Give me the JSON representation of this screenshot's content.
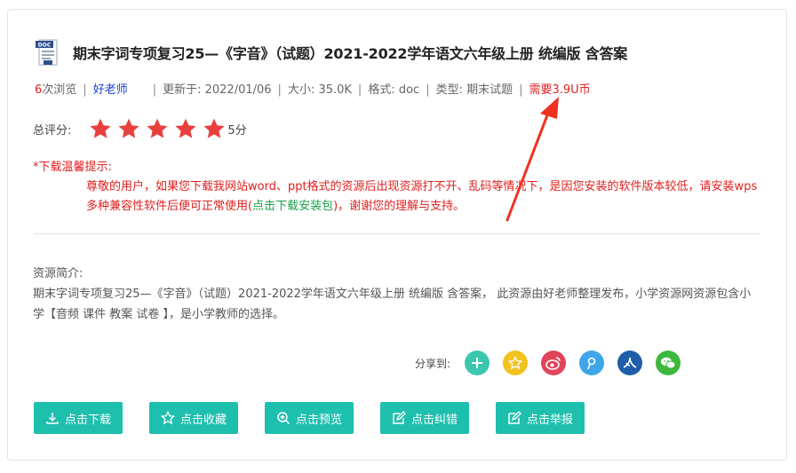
{
  "resource": {
    "doc_badge": "DOC",
    "title": "期末字词专项复习25—《字音》（试题）2021-2022学年语文六年级上册 统编版 含答案",
    "views_count": "6",
    "views_suffix": "次浏览",
    "author": "好老师",
    "updated": "更新于: 2022/01/06",
    "size": "大小: 35.0K",
    "format": "格式: doc",
    "type": "类型: 期末试题",
    "price": "需要3.9U币"
  },
  "rating": {
    "label": "总评分:",
    "stars": 5,
    "score": "5分",
    "star_color": "#e8413d"
  },
  "download_tip": {
    "heading": "*下载温馨提示:",
    "text_before": "尊敬的用户，如果您下载我网站word、ppt格式的资源后出现资源打不开、乱码等情况下，是因您安装的软件版本较低，请安装wps多种兼容性软件后便可正常使用(",
    "link": "点击下载安装包",
    "text_after": ")，谢谢您的理解与支持。"
  },
  "intro": {
    "label": "资源简介:",
    "text": "期末字词专项复习25—《字音》（试题）2021-2022学年语文六年级上册 统编版 含答案， 此资源由好老师整理发布，小学资源网资源包含小学【音频 课件 教案 试卷 】，是小学教师的选择。"
  },
  "share": {
    "label": "分享到:",
    "buttons": [
      {
        "icon": "plus-icon",
        "color": "#3cc6b0"
      },
      {
        "icon": "star-favorite-icon",
        "color": "#f2c21f"
      },
      {
        "icon": "weibo-icon",
        "color": "#e0455a"
      },
      {
        "icon": "tencent-weibo-icon",
        "color": "#3ea6e8"
      },
      {
        "icon": "renren-icon",
        "color": "#1e5ea8"
      },
      {
        "icon": "wechat-icon",
        "color": "#3db73d"
      }
    ]
  },
  "actions": {
    "download": "点击下载",
    "favorite": "点击收藏",
    "preview": "点击预览",
    "correct": "点击纠错",
    "report": "点击举报",
    "color": "#1fbfae"
  },
  "annotation": {
    "arrow_color": "#f03020"
  }
}
